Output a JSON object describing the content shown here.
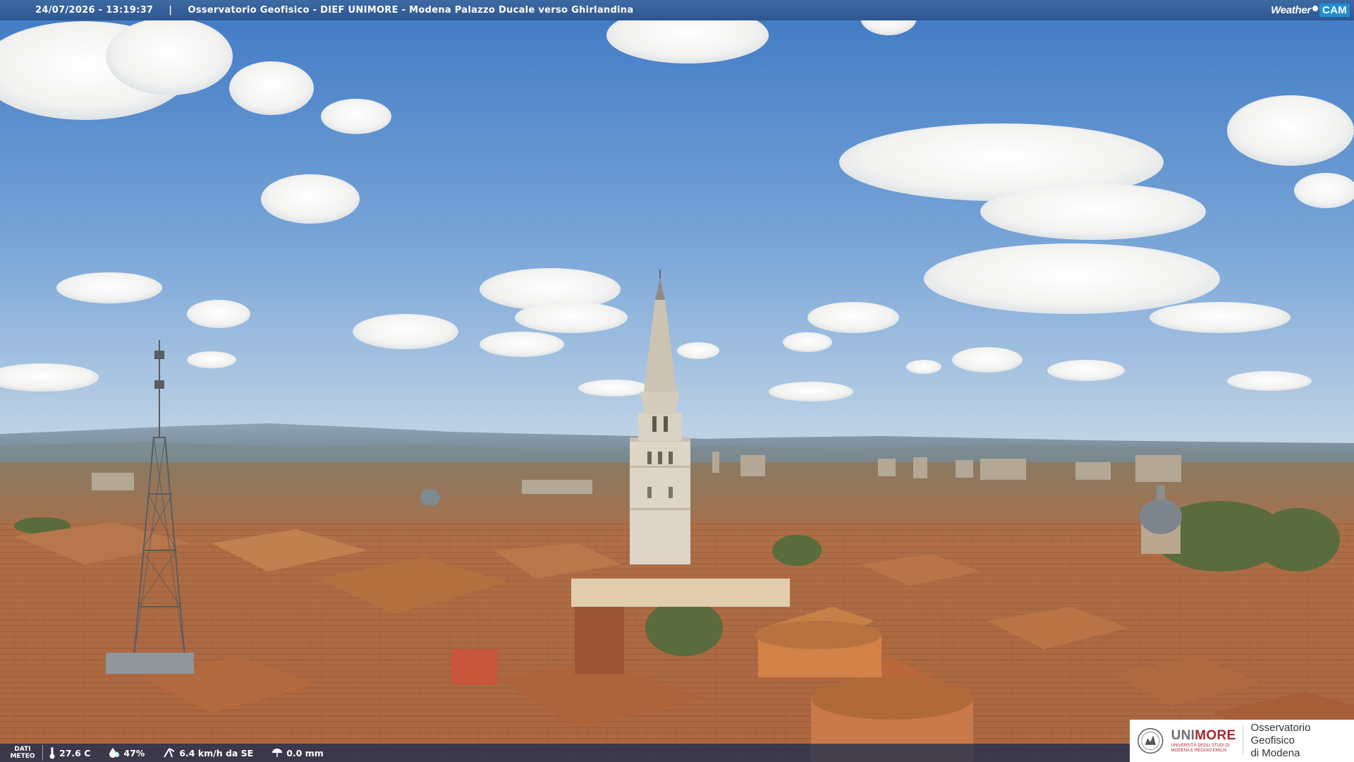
{
  "header": {
    "timestamp": "24/07/2026 - 13:19:37",
    "separator": "|",
    "title": "Osservatorio Geofisico - DIEF UNIMORE - Modena Palazzo Ducale verso Ghirlandina",
    "brand_left": "Weather",
    "brand_right": "CAM"
  },
  "meteo": {
    "label_line1": "DATI",
    "label_line2": "METEO",
    "temperature": "27.6 C",
    "humidity": "47%",
    "wind": "6.4 km/h da SE",
    "rain": "0.0 mm",
    "icons": [
      "thermometer-icon",
      "humidity-drop-icon",
      "wind-icon",
      "rain-icon"
    ]
  },
  "logo": {
    "uni_name_1": "UNI",
    "uni_name_2": "MORE",
    "uni_sub_1": "UNIVERSITÀ DEGLI STUDI DI",
    "uni_sub_2": "MODENA E REGGIO EMILIA",
    "observatory_line1": "Osservatorio Geofisico",
    "observatory_line2": "di Modena"
  },
  "colors": {
    "sky_top": "#3f79c4",
    "sky_bottom": "#b9cfe4",
    "roof": "#b06a3f",
    "header_bar": "#2d5690",
    "unimore_red": "#a6262f"
  }
}
